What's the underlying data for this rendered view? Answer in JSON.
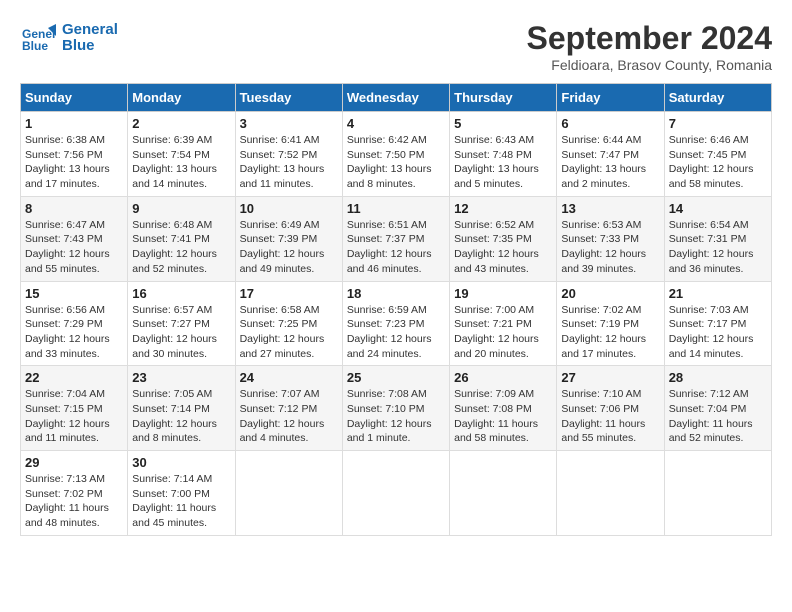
{
  "header": {
    "logo_line1": "General",
    "logo_line2": "Blue",
    "month": "September 2024",
    "location": "Feldioara, Brasov County, Romania"
  },
  "weekdays": [
    "Sunday",
    "Monday",
    "Tuesday",
    "Wednesday",
    "Thursday",
    "Friday",
    "Saturday"
  ],
  "weeks": [
    [
      {
        "day": "1",
        "info": "Sunrise: 6:38 AM\nSunset: 7:56 PM\nDaylight: 13 hours and 17 minutes."
      },
      {
        "day": "2",
        "info": "Sunrise: 6:39 AM\nSunset: 7:54 PM\nDaylight: 13 hours and 14 minutes."
      },
      {
        "day": "3",
        "info": "Sunrise: 6:41 AM\nSunset: 7:52 PM\nDaylight: 13 hours and 11 minutes."
      },
      {
        "day": "4",
        "info": "Sunrise: 6:42 AM\nSunset: 7:50 PM\nDaylight: 13 hours and 8 minutes."
      },
      {
        "day": "5",
        "info": "Sunrise: 6:43 AM\nSunset: 7:48 PM\nDaylight: 13 hours and 5 minutes."
      },
      {
        "day": "6",
        "info": "Sunrise: 6:44 AM\nSunset: 7:47 PM\nDaylight: 13 hours and 2 minutes."
      },
      {
        "day": "7",
        "info": "Sunrise: 6:46 AM\nSunset: 7:45 PM\nDaylight: 12 hours and 58 minutes."
      }
    ],
    [
      {
        "day": "8",
        "info": "Sunrise: 6:47 AM\nSunset: 7:43 PM\nDaylight: 12 hours and 55 minutes."
      },
      {
        "day": "9",
        "info": "Sunrise: 6:48 AM\nSunset: 7:41 PM\nDaylight: 12 hours and 52 minutes."
      },
      {
        "day": "10",
        "info": "Sunrise: 6:49 AM\nSunset: 7:39 PM\nDaylight: 12 hours and 49 minutes."
      },
      {
        "day": "11",
        "info": "Sunrise: 6:51 AM\nSunset: 7:37 PM\nDaylight: 12 hours and 46 minutes."
      },
      {
        "day": "12",
        "info": "Sunrise: 6:52 AM\nSunset: 7:35 PM\nDaylight: 12 hours and 43 minutes."
      },
      {
        "day": "13",
        "info": "Sunrise: 6:53 AM\nSunset: 7:33 PM\nDaylight: 12 hours and 39 minutes."
      },
      {
        "day": "14",
        "info": "Sunrise: 6:54 AM\nSunset: 7:31 PM\nDaylight: 12 hours and 36 minutes."
      }
    ],
    [
      {
        "day": "15",
        "info": "Sunrise: 6:56 AM\nSunset: 7:29 PM\nDaylight: 12 hours and 33 minutes."
      },
      {
        "day": "16",
        "info": "Sunrise: 6:57 AM\nSunset: 7:27 PM\nDaylight: 12 hours and 30 minutes."
      },
      {
        "day": "17",
        "info": "Sunrise: 6:58 AM\nSunset: 7:25 PM\nDaylight: 12 hours and 27 minutes."
      },
      {
        "day": "18",
        "info": "Sunrise: 6:59 AM\nSunset: 7:23 PM\nDaylight: 12 hours and 24 minutes."
      },
      {
        "day": "19",
        "info": "Sunrise: 7:00 AM\nSunset: 7:21 PM\nDaylight: 12 hours and 20 minutes."
      },
      {
        "day": "20",
        "info": "Sunrise: 7:02 AM\nSunset: 7:19 PM\nDaylight: 12 hours and 17 minutes."
      },
      {
        "day": "21",
        "info": "Sunrise: 7:03 AM\nSunset: 7:17 PM\nDaylight: 12 hours and 14 minutes."
      }
    ],
    [
      {
        "day": "22",
        "info": "Sunrise: 7:04 AM\nSunset: 7:15 PM\nDaylight: 12 hours and 11 minutes."
      },
      {
        "day": "23",
        "info": "Sunrise: 7:05 AM\nSunset: 7:14 PM\nDaylight: 12 hours and 8 minutes."
      },
      {
        "day": "24",
        "info": "Sunrise: 7:07 AM\nSunset: 7:12 PM\nDaylight: 12 hours and 4 minutes."
      },
      {
        "day": "25",
        "info": "Sunrise: 7:08 AM\nSunset: 7:10 PM\nDaylight: 12 hours and 1 minute."
      },
      {
        "day": "26",
        "info": "Sunrise: 7:09 AM\nSunset: 7:08 PM\nDaylight: 11 hours and 58 minutes."
      },
      {
        "day": "27",
        "info": "Sunrise: 7:10 AM\nSunset: 7:06 PM\nDaylight: 11 hours and 55 minutes."
      },
      {
        "day": "28",
        "info": "Sunrise: 7:12 AM\nSunset: 7:04 PM\nDaylight: 11 hours and 52 minutes."
      }
    ],
    [
      {
        "day": "29",
        "info": "Sunrise: 7:13 AM\nSunset: 7:02 PM\nDaylight: 11 hours and 48 minutes."
      },
      {
        "day": "30",
        "info": "Sunrise: 7:14 AM\nSunset: 7:00 PM\nDaylight: 11 hours and 45 minutes."
      },
      {
        "day": "",
        "info": ""
      },
      {
        "day": "",
        "info": ""
      },
      {
        "day": "",
        "info": ""
      },
      {
        "day": "",
        "info": ""
      },
      {
        "day": "",
        "info": ""
      }
    ]
  ]
}
